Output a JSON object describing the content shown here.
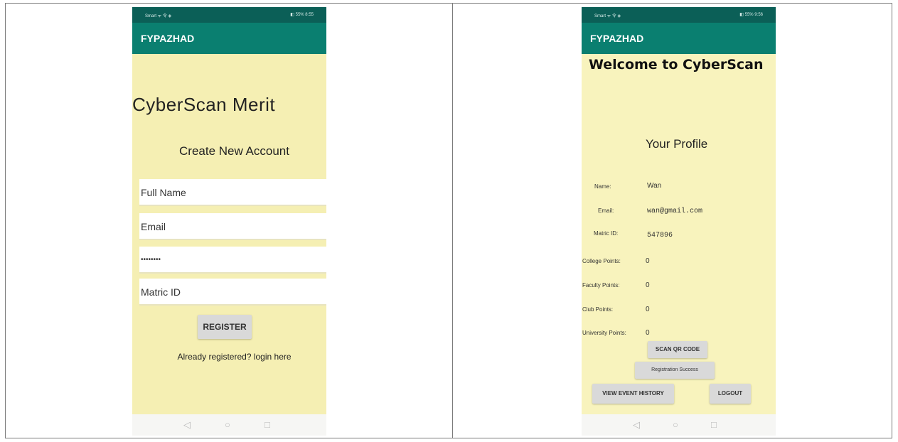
{
  "left_screen": {
    "status_left": "Smart ᯤ 令 ◈",
    "status_right": "◧ 55% 8:55",
    "app_title": "FYPAZHAD",
    "main_title": "CyberScan Merit",
    "subtitle": "Create New Account",
    "fields": {
      "full_name": "Full Name",
      "email": "Email",
      "password": "••••••••",
      "matric_id": "Matric ID"
    },
    "register_label": "REGISTER",
    "login_link": "Already registered? login here",
    "nav": {
      "back": "◁",
      "home": "○",
      "recent": "□"
    }
  },
  "right_screen": {
    "status_left": "Smart ᯤ 令 ◈",
    "status_right": "◧ 55% 9:56",
    "app_title": "FYPAZHAD",
    "welcome": "Welcome to CyberScan",
    "profile_title": "Your Profile",
    "profile": {
      "name_label": "Name:",
      "name_value": "Wan",
      "email_label": "Email:",
      "email_value": "wan@gmail.com",
      "matric_label": "Matric ID:",
      "matric_value": "547896",
      "college_label": "College Points:",
      "college_value": "0",
      "faculty_label": "Faculty Points:",
      "faculty_value": "0",
      "club_label": "Club Points:",
      "club_value": "0",
      "university_label": "University Points:",
      "university_value": "0"
    },
    "scan_label": "SCAN QR CODE",
    "toast": "Registration Success",
    "history_label": "VIEW EVENT HISTORY",
    "logout_label": "LOGOUT",
    "nav": {
      "back": "◁",
      "home": "○",
      "recent": "□"
    }
  }
}
